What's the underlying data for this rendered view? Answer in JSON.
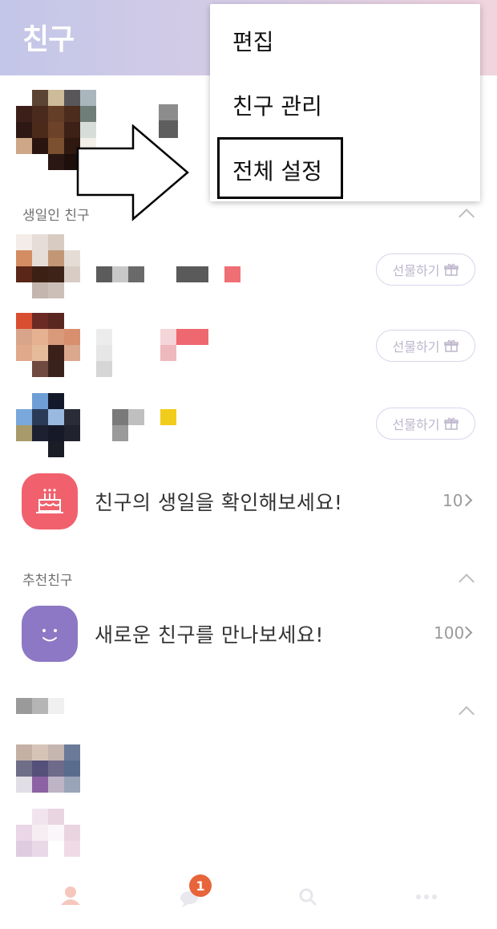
{
  "header": {
    "title": "친구"
  },
  "menu": {
    "items": [
      {
        "label": "편집"
      },
      {
        "label": "친구 관리"
      },
      {
        "label": "전체 설정"
      }
    ]
  },
  "sections": {
    "birthday": {
      "label": "생일인 친구",
      "gift_label": "선물하기",
      "summary_text": "친구의 생일을 확인해보세요!",
      "summary_count": "10"
    },
    "recommended": {
      "label": "추천친구",
      "summary_text": "새로운 친구를 만나보세요!",
      "summary_count": "100"
    }
  },
  "bottom_nav": {
    "badge": "1",
    "icons": [
      "person-icon",
      "chat-icon",
      "search-icon",
      "more-icon"
    ]
  },
  "colors": {
    "header_gradient_start": "#c3c6e8",
    "header_gradient_end": "#f1d4de",
    "birthday_icon_bg": "#f0616d",
    "recommend_icon_bg": "#8c78c4",
    "badge": "#e8643a"
  }
}
